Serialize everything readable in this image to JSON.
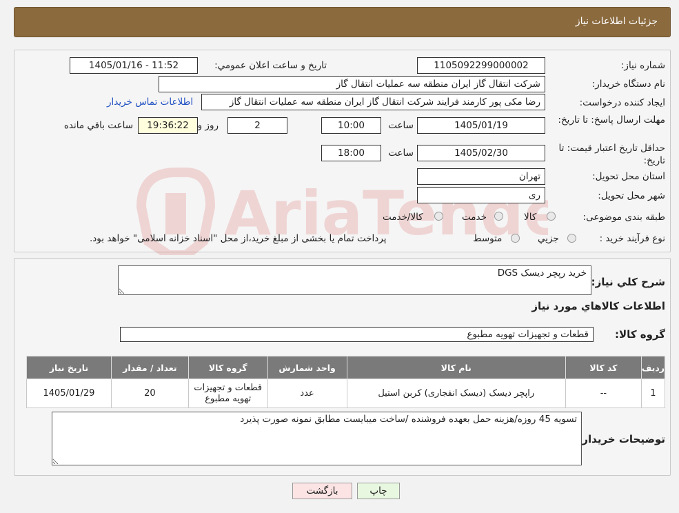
{
  "header": {
    "title": "جزئیات اطلاعات نیاز"
  },
  "form": {
    "need_number_label": "شماره نیاز:",
    "need_number": "1105092299000002",
    "announce_label": "تاريخ و ساعت اعلان عمومي:",
    "announce_value": "1405/01/16 - 11:52",
    "buyer_org_label": "نام دستگاه خريدار:",
    "buyer_org": "شركت انتقال گاز ايران منطقه سه عمليات انتقال گاز",
    "creator_label": "ايجاد كننده درخواست:",
    "creator": "رضا مکی پور کارمند فرایند شركت انتقال گاز ايران منطقه سه عمليات انتقال گاز",
    "contact_link": "اطلاعات تماس خريدار",
    "deadline_label": "مهلت ارسال پاسخ: تا تاریخ:",
    "deadline_date": "1405/01/19",
    "time_label": "ساعت",
    "deadline_time": "10:00",
    "days_value": "2",
    "days_label": "روز و",
    "remaining_time": "19:36:22",
    "remaining_label": "ساعت باقي مانده",
    "validity_label": "حداقل تاريخ اعتبار قيمت: تا تاریخ:",
    "validity_date": "1405/02/30",
    "validity_time": "18:00",
    "province_label": "استان محل تحويل:",
    "province": "تهران",
    "city_label": "شهر محل تحويل:",
    "city": "ری",
    "category_label": "طبقه بندی موضوعی:",
    "category_options": [
      "كالا",
      "خدمت",
      "كالا/خدمت"
    ],
    "process_label": "نوع فرآيند خريد :",
    "process_options": [
      "جزيي",
      "متوسط"
    ],
    "process_note": "پرداخت تمام يا بخشی از مبلغ خريد،از محل \"اسناد خزانه اسلامی\" خواهد بود."
  },
  "details": {
    "summary_label": "شرح كلي نياز:",
    "summary": "خرید رپچر دیسک DGS",
    "goods_info_title": "اطلاعات كالاهاي مورد نياز",
    "group_label": "گروه كالا:",
    "group": "قطعات و تجهیزات تهویه مطبوع",
    "table": {
      "headers": [
        "رديف",
        "كد كالا",
        "نام كالا",
        "واحد شمارش",
        "گروه كالا",
        "تعداد / مقدار",
        "تاريخ نياز"
      ],
      "rows": [
        [
          "1",
          "--",
          "راپچر دیسک (دیسک انفجاری) کربن استیل",
          "عدد",
          "قطعات و تجهیزات تهویه مطبوع",
          "20",
          "1405/01/29"
        ]
      ]
    },
    "buyer_notes_label": "توضيحات خريدار:",
    "buyer_notes": "تسویه 45 روزه/هزینه حمل بعهده فروشنده /ساخت میبایست مطابق نمونه صورت پذیرد"
  },
  "buttons": {
    "print": "چاپ",
    "back": "بازگشت"
  },
  "colors": {
    "header_bg": "#8b6a3e",
    "table_header_bg": "#7a7a7a",
    "print_bg": "#e8f8e0",
    "back_bg": "#fce4e4"
  }
}
